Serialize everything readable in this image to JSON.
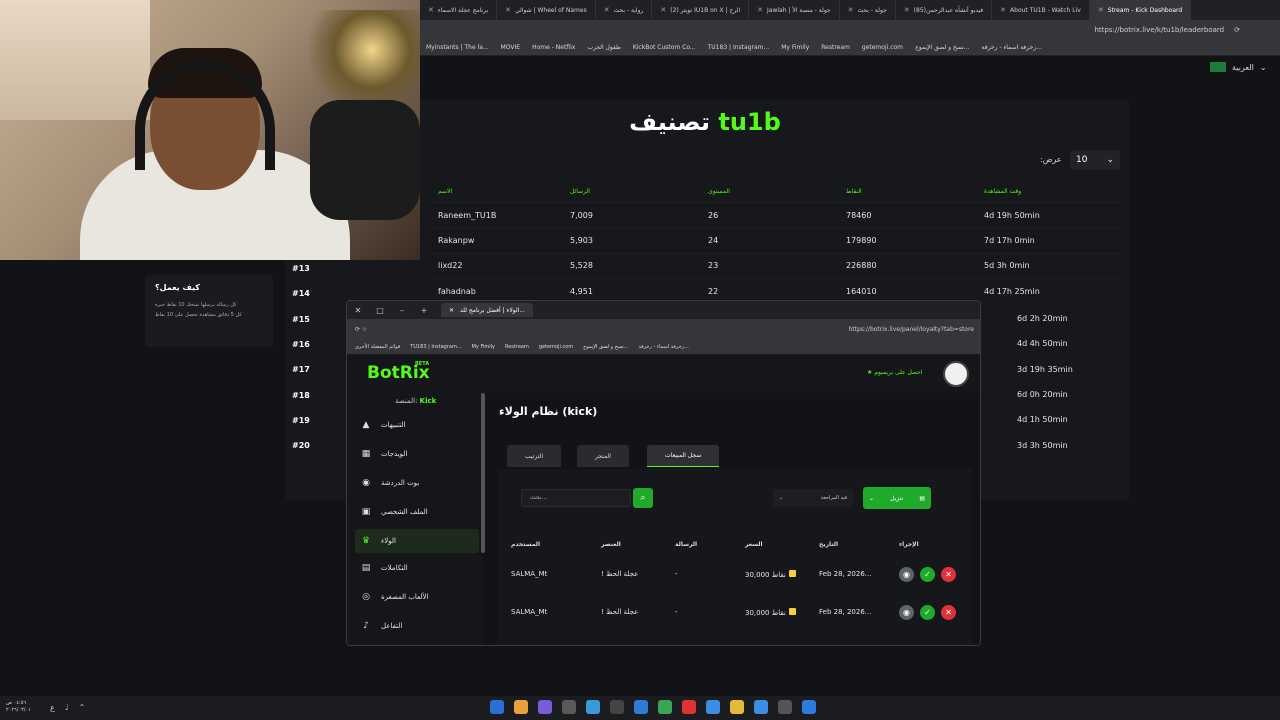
{
  "browser": {
    "tabs": [
      {
        "label": "Stream - Kick Dashboard",
        "active": true
      },
      {
        "label": "About TU1B - Watch Liv"
      },
      {
        "label": "(85)فيديو أنشأه عبدالرحمن"
      },
      {
        "label": "جولة - بحث"
      },
      {
        "label": "Jawlah | جولة - منصة الأ"
      },
      {
        "label": "تويتر (2) IU1B on X | الرح"
      },
      {
        "label": "رواية - بحث"
      },
      {
        "label": "شوالي | Wheel of Names"
      },
      {
        "label": "برنامج عجلة الاسماء"
      }
    ],
    "url": "https://botrix.live/k/tu1b/leaderboard",
    "bookmarks": [
      "Myinstants | The la...",
      "MOVIE",
      "Home - Netflix",
      "طفول الحرب",
      "KickBot Custom Co...",
      "TU183 | Instagram...",
      "My Fimily",
      "Restream",
      "getemoji.com",
      "نسخ و لصق الإيموج...",
      "زخرفة اسماء - زخرفة..."
    ]
  },
  "page": {
    "language": "العربية",
    "title_prefix": "تصنيف",
    "title_highlight": "tu1b",
    "show_label": ":عرض",
    "show_value": "10",
    "headers": [
      "الاسم",
      "الرسائل",
      "المستوى",
      "النقاط",
      "وقت المشاهدة"
    ],
    "rows": [
      {
        "name": "Raneem_TU1B",
        "messages": "7,009",
        "level": "26",
        "points": "78460",
        "watch": "4d 19h 50min"
      },
      {
        "name": "Rakanpw",
        "messages": "5,903",
        "level": "24",
        "points": "179890",
        "watch": "7d 17h 0min"
      },
      {
        "name": "lixd22",
        "messages": "5,528",
        "level": "23",
        "points": "226880",
        "watch": "5d 3h 0min"
      },
      {
        "name": "fahadnab",
        "messages": "4,951",
        "level": "22",
        "points": "164010",
        "watch": "4d 17h 25min"
      }
    ],
    "ranks": [
      "#13",
      "#14",
      "#15",
      "#16",
      "#17",
      "#18",
      "#19",
      "#20"
    ],
    "extra_watch": [
      "6d 2h 20min",
      "4d 4h 50min",
      "3d 19h 35min",
      "6d 0h 20min",
      "4d 1h 50min",
      "3d 3h 50min"
    ],
    "how_title": "كيف يعمل؟",
    "how_lines": [
      "كل رسالة ترسلها تمنحك 10 نقاط خبرة",
      "كل 5 دقائق مشاهدة تحصل على 10 نقاط"
    ]
  },
  "botrix": {
    "tab_label": "الولاء | أفضل برنامج للد...",
    "url": "https://botrix.live/panel/loyalty?tab=store",
    "bm_left": "قوائم المفضلة الأخرى",
    "bookmarks": [
      "TU183 | Instagram...",
      "My Fimily",
      "Restream",
      "getemoji.com",
      "نسخ و لصق الإيموج...",
      "زخرفة اسماء - زخرفة..."
    ],
    "logo": "BotRix",
    "beta": "BETA",
    "premium": "احصل على بريميوم",
    "platform_label": "المنصة:",
    "platform_value": "Kick",
    "nav": [
      "التنبيهات",
      "الويدجات",
      "بوت الدردشة",
      "الملف الشخصي",
      "الولاء",
      "التكاملات",
      "الألعاب المصغرة",
      "التفاعل"
    ],
    "page_title": "نظام الولاء (kick)",
    "tabs": [
      "الترتيب",
      "المتجر",
      "سجل المبيعات"
    ],
    "search_placeholder": "بحث...",
    "filter": "قيد المراجعة",
    "download": "تنزيل",
    "headers": [
      "المستخدم",
      "العنصر",
      "الرسالة",
      "السعر",
      "التاريخ",
      "الإجراء"
    ],
    "rows": [
      {
        "user": "SALMA_Mt",
        "item": "! عجلة الحظ",
        "message": "-",
        "price": "30,000",
        "price_unit": "نقاط",
        "date": "Feb 28, 2026..."
      },
      {
        "user": "SALMA_Mt",
        "item": "! عجلة الحظ",
        "message": "-",
        "price": "30,000",
        "price_unit": "نقاط",
        "date": "Feb 28, 2026..."
      }
    ]
  },
  "taskbar": {
    "time": "٠٤:٥٦ ص",
    "date": "٢٠٢٦/٠٣/٠١",
    "lang": "ع"
  },
  "colors": {
    "accent": "#53fc18",
    "button": "#1faa2c",
    "danger": "#e0323b"
  }
}
